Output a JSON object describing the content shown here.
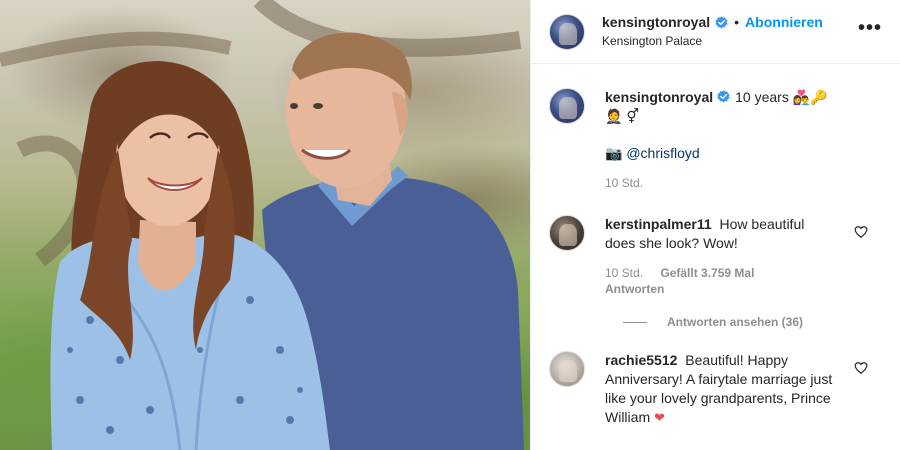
{
  "header": {
    "username": "kensingtonroyal",
    "follow_label": "Abonnieren",
    "location": "Kensington Palace",
    "more_label": "•••"
  },
  "caption": {
    "username": "kensingtonroyal",
    "text": "10 years",
    "emoji_1": "👩‍❤️‍👨",
    "emoji_2": "🔑",
    "emoji_3": "🤵",
    "emoji_4": "⚥",
    "camera_emoji": "📷",
    "mention": "@chrisfloyd",
    "time": "10 Std."
  },
  "comments": [
    {
      "username": "kerstinpalmer11",
      "text": "How beautiful does she look? Wow!",
      "time": "10 Std.",
      "likes": "Gefällt 3.759 Mal",
      "reply_label": "Antworten",
      "view_replies": "Antworten ansehen (36)"
    },
    {
      "username": "rachie5512",
      "text": "Beautiful! Happy Anniversary! A fairytale marriage just like your lovely grandparents, Prince William",
      "heart": "❤"
    }
  ],
  "colors": {
    "accent": "#0095f6",
    "text": "#262626",
    "muted": "#8e8e8e",
    "mention": "#00376b",
    "heart": "#ed4956"
  },
  "icons": {
    "verified": "verified-badge-icon",
    "heart": "heart-outline-icon",
    "more": "more-horizontal-icon"
  }
}
